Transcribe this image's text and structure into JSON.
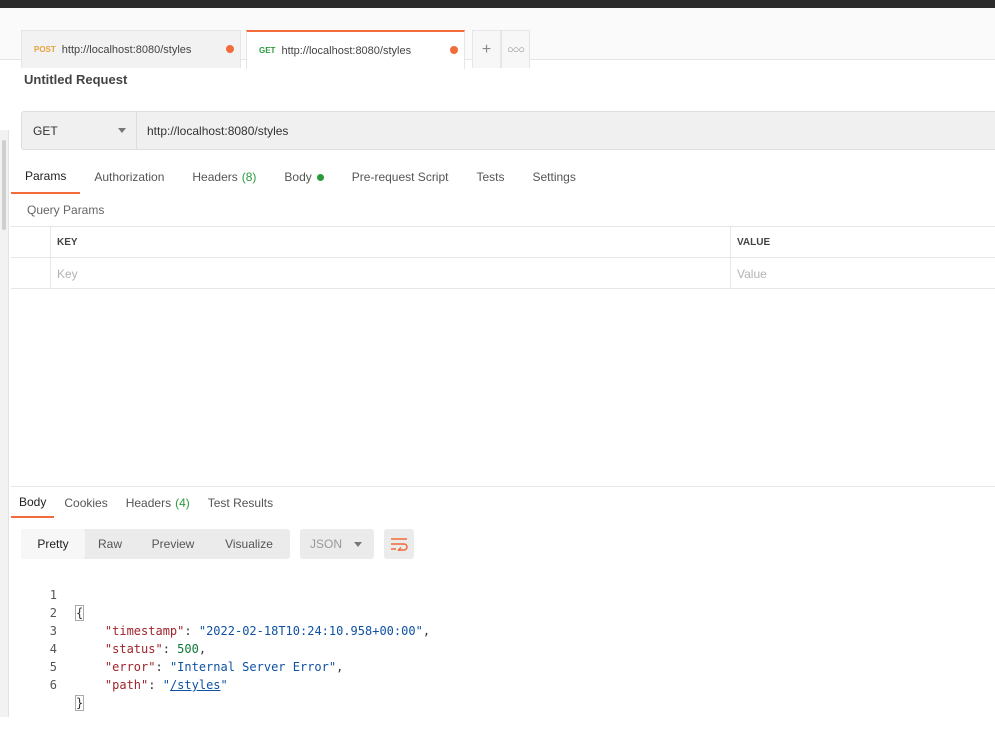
{
  "tabs": [
    {
      "method": "POST",
      "url": "http://localhost:8080/styles"
    },
    {
      "method": "GET",
      "url": "http://localhost:8080/styles"
    }
  ],
  "request": {
    "title": "Untitled Request",
    "method": "GET",
    "url": "http://localhost:8080/styles"
  },
  "request_tabs": {
    "params": "Params",
    "authorization": "Authorization",
    "headers": "Headers",
    "headers_count": "(8)",
    "body": "Body",
    "prerequest": "Pre-request Script",
    "tests": "Tests",
    "settings": "Settings"
  },
  "query_params": {
    "label": "Query Params",
    "key_header": "KEY",
    "value_header": "VALUE",
    "key_placeholder": "Key",
    "value_placeholder": "Value"
  },
  "response_tabs": {
    "body": "Body",
    "cookies": "Cookies",
    "headers": "Headers",
    "headers_count": "(4)",
    "test_results": "Test Results"
  },
  "view_modes": {
    "pretty": "Pretty",
    "raw": "Raw",
    "preview": "Preview",
    "visualize": "Visualize",
    "format": "JSON"
  },
  "response_body": {
    "line_numbers": [
      "1",
      "2",
      "3",
      "4",
      "5",
      "6"
    ],
    "open_brace": "{",
    "close_brace": "}",
    "timestamp_key": "\"timestamp\"",
    "timestamp_value": "\"2022-02-18T10:24:10.958+00:00\"",
    "status_key": "\"status\"",
    "status_value": "500",
    "error_key": "\"error\"",
    "error_value": "\"Internal Server Error\"",
    "path_key": "\"path\"",
    "path_value": "/styles"
  },
  "colors": {
    "accent": "#f26b3a",
    "success": "#2b9a3f",
    "json_key": "#a0232b",
    "json_string": "#0f52a3"
  }
}
